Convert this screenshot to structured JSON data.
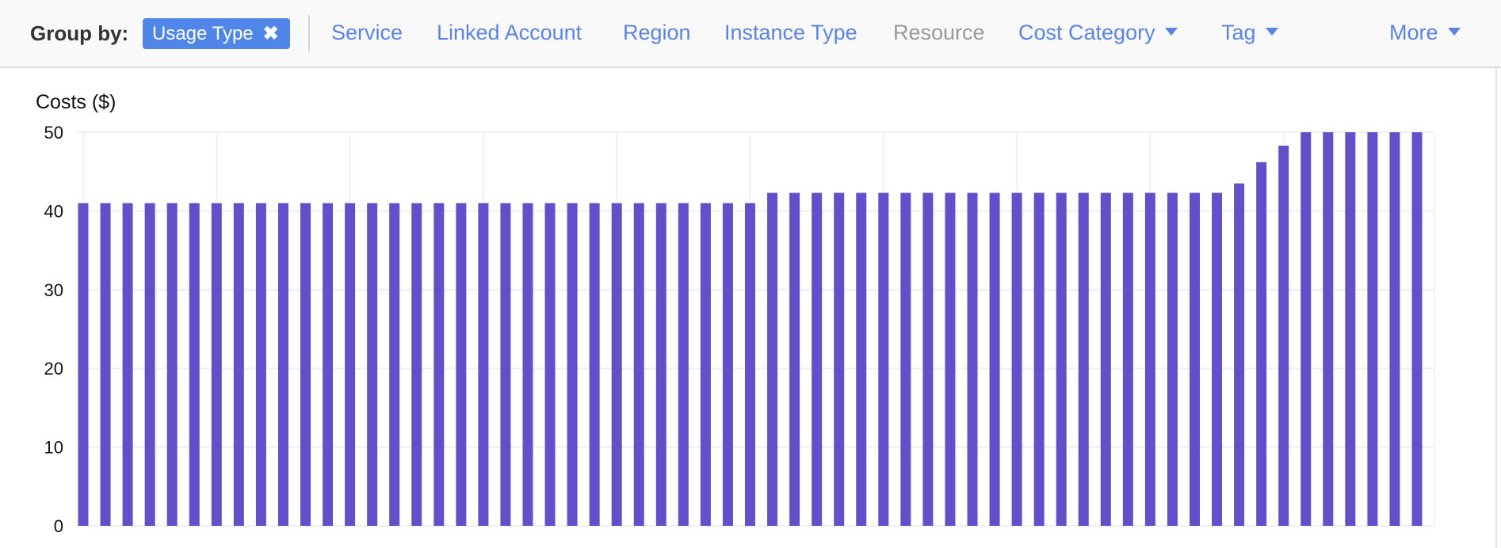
{
  "toolbar": {
    "group_by_label": "Group by:",
    "active_chip": {
      "label": "Usage Type",
      "remove_icon": "close-icon"
    },
    "options": [
      {
        "label": "Service",
        "enabled": true,
        "dropdown": false
      },
      {
        "label": "Linked Account",
        "enabled": true,
        "dropdown": false
      },
      {
        "label": "Region",
        "enabled": true,
        "dropdown": false
      },
      {
        "label": "Instance Type",
        "enabled": true,
        "dropdown": false
      },
      {
        "label": "Resource",
        "enabled": false,
        "dropdown": false
      },
      {
        "label": "Cost Category",
        "enabled": true,
        "dropdown": true
      },
      {
        "label": "Tag",
        "enabled": true,
        "dropdown": true
      }
    ],
    "more_label": "More"
  },
  "colors": {
    "bar": "#634fc9",
    "link": "#5a84e3",
    "chip": "#4f86e8"
  },
  "chart_data": {
    "type": "bar",
    "ylabel": "Costs ($)",
    "ylim": [
      0,
      50
    ],
    "yticks": [
      0,
      10,
      20,
      30,
      40,
      50
    ],
    "grid": true,
    "values": [
      41,
      41,
      41,
      41,
      41,
      41,
      41,
      41,
      41,
      41,
      41,
      41,
      41,
      41,
      41,
      41,
      41,
      41,
      41,
      41,
      41,
      41,
      41,
      41,
      41,
      41,
      41,
      41,
      41,
      41,
      41,
      42.3,
      42.3,
      42.3,
      42.3,
      42.3,
      42.3,
      42.3,
      42.3,
      42.3,
      42.3,
      42.3,
      42.3,
      42.3,
      42.3,
      42.3,
      42.3,
      42.3,
      42.3,
      42.3,
      42.3,
      42.3,
      43.5,
      46.2,
      48.3,
      50,
      50,
      50,
      50,
      50,
      50
    ]
  }
}
